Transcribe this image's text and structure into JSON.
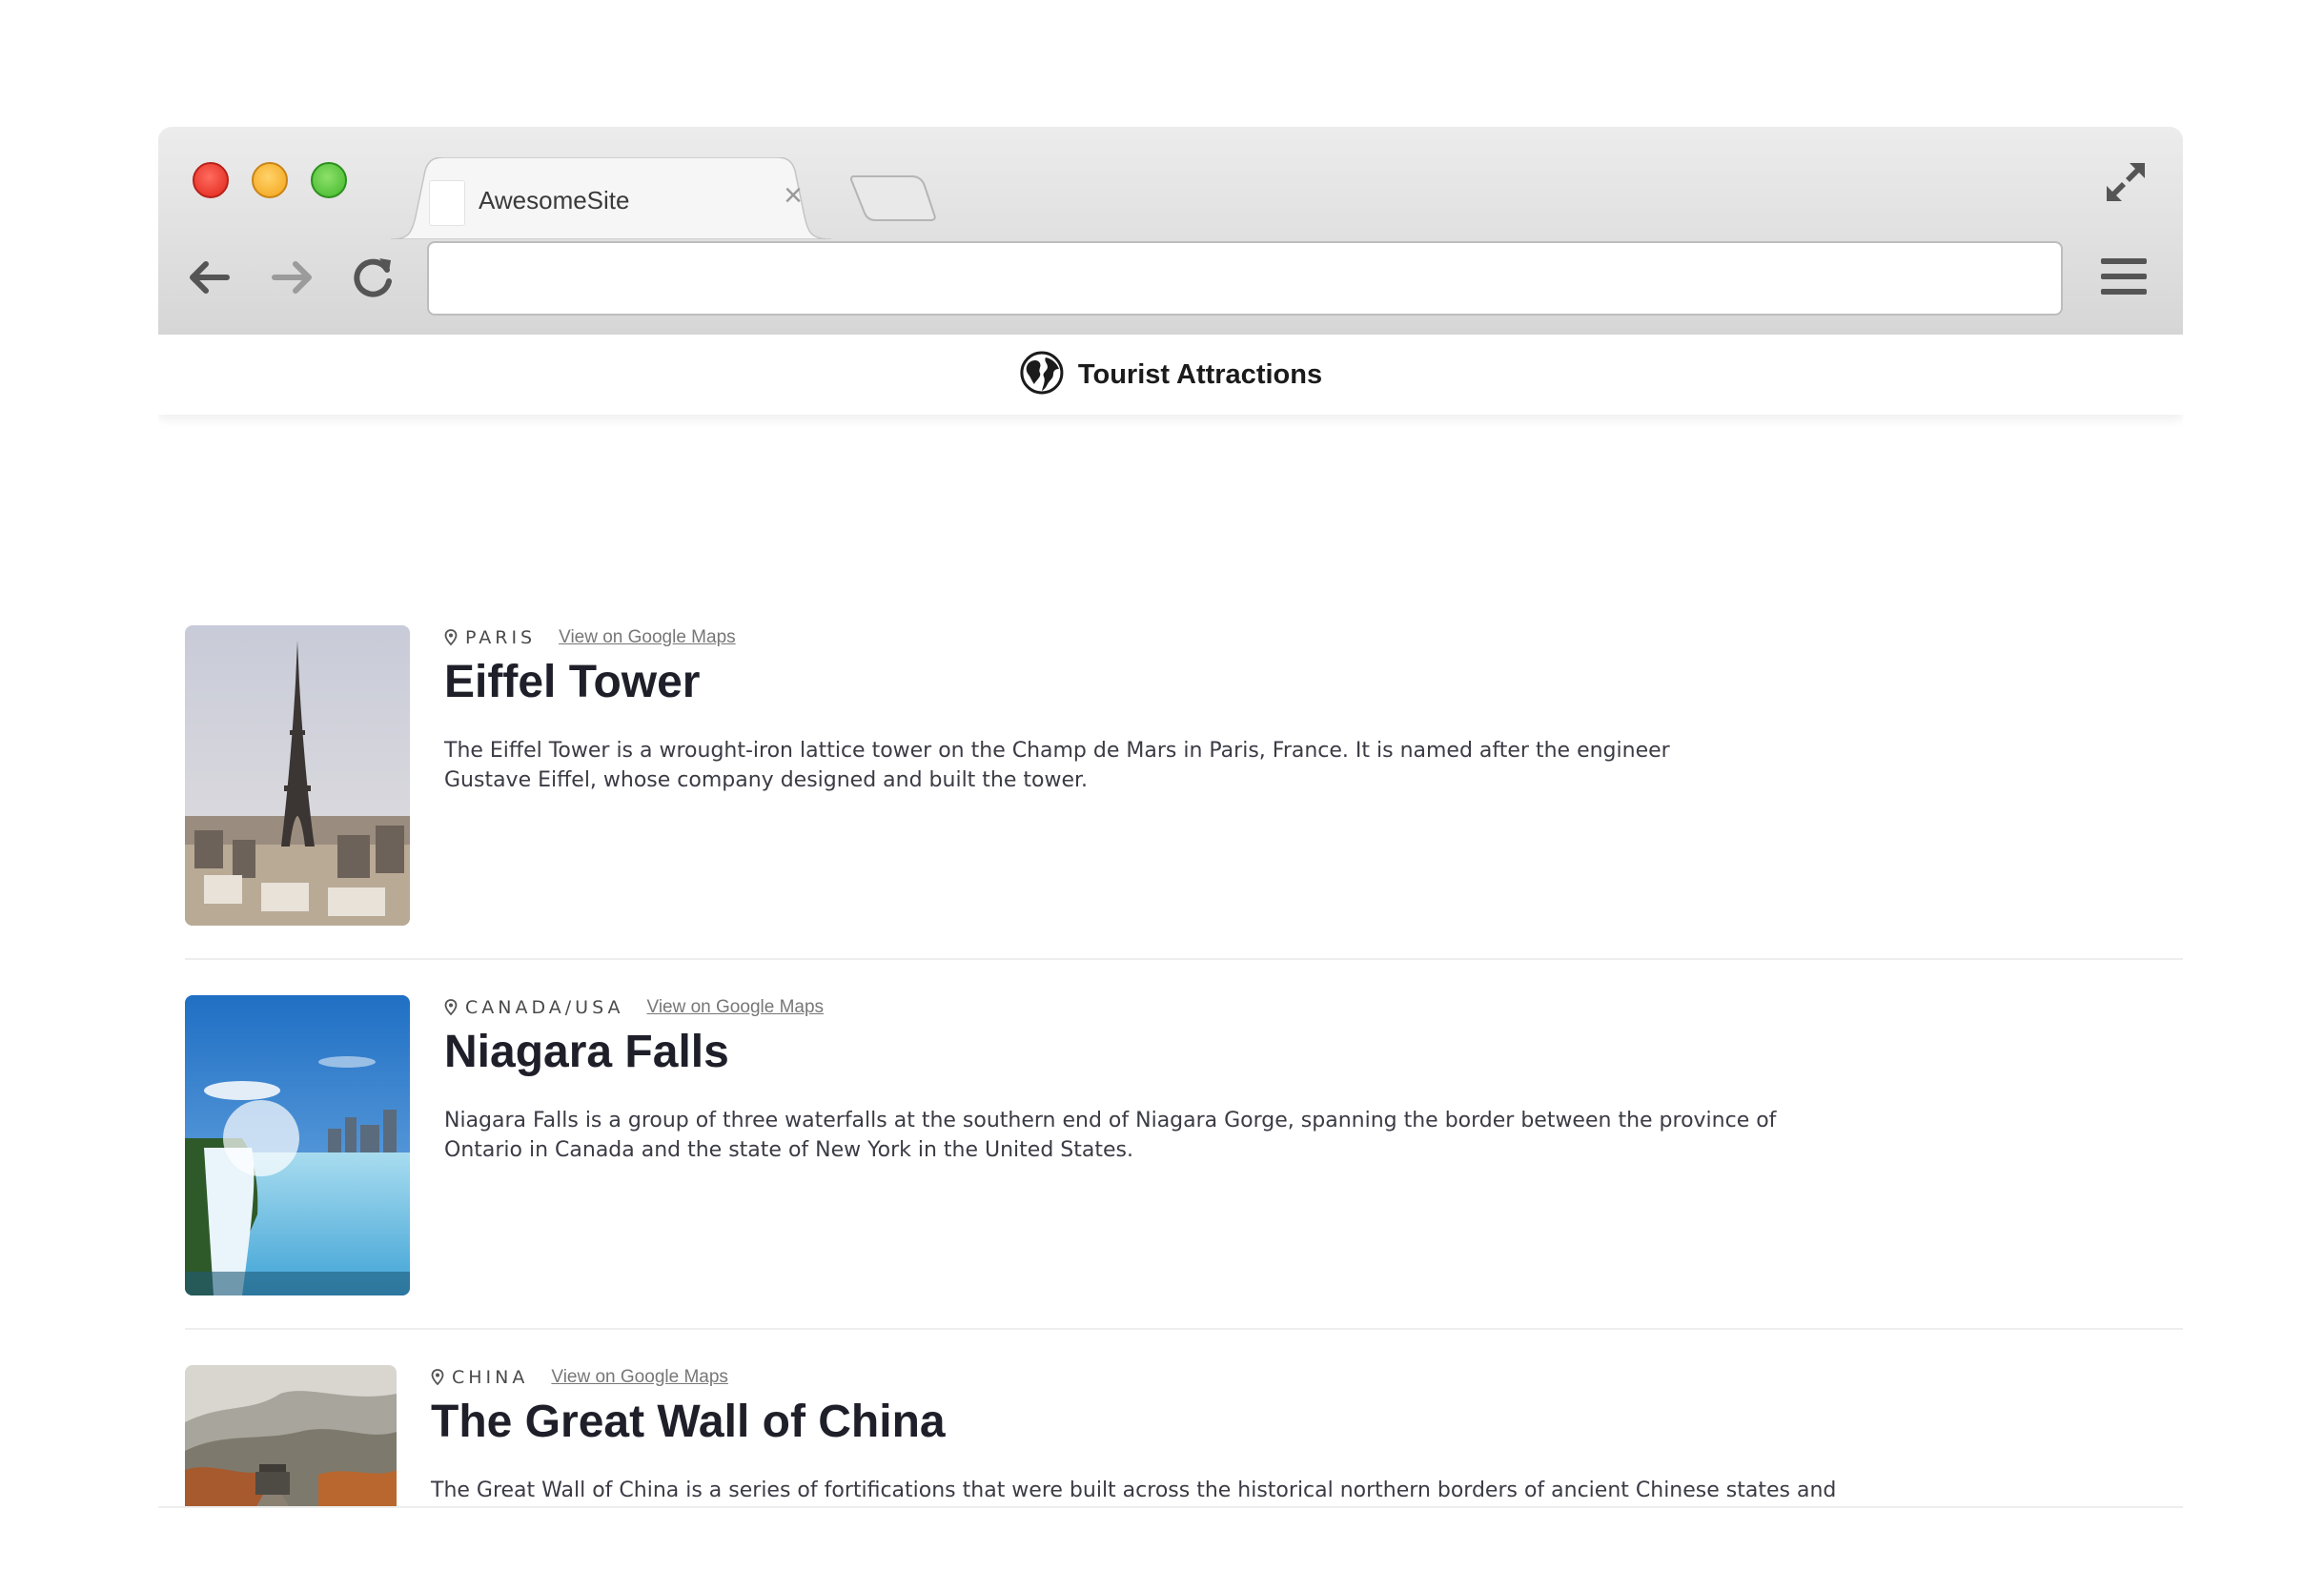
{
  "browser": {
    "tab_title": "AwesomeSite",
    "tab_close": "×",
    "address_value": ""
  },
  "site": {
    "title": "Tourist Attractions"
  },
  "attractions": [
    {
      "location": "PARIS",
      "link_label": "View on Google Maps",
      "name": "Eiffel Tower",
      "description": "The Eiffel Tower is a wrought-iron lattice tower on the Champ de Mars in Paris, France. It is named after the engineer Gustave Eiffel, whose company designed and built the tower."
    },
    {
      "location": "CANADA/USA",
      "link_label": "View on Google Maps",
      "name": "Niagara Falls",
      "description": "Niagara Falls is a group of three waterfalls at the southern end of Niagara Gorge, spanning the border between the province of Ontario in Canada and the state of New York in the United States."
    },
    {
      "location": "CHINA",
      "link_label": "View on Google Maps",
      "name": "The Great Wall of China",
      "description": "The Great Wall of China is a series of fortifications that were built across the historical northern borders of ancient Chinese states and Imperial China as protection against various nomadic groups from the Eurasian Steppe."
    }
  ]
}
